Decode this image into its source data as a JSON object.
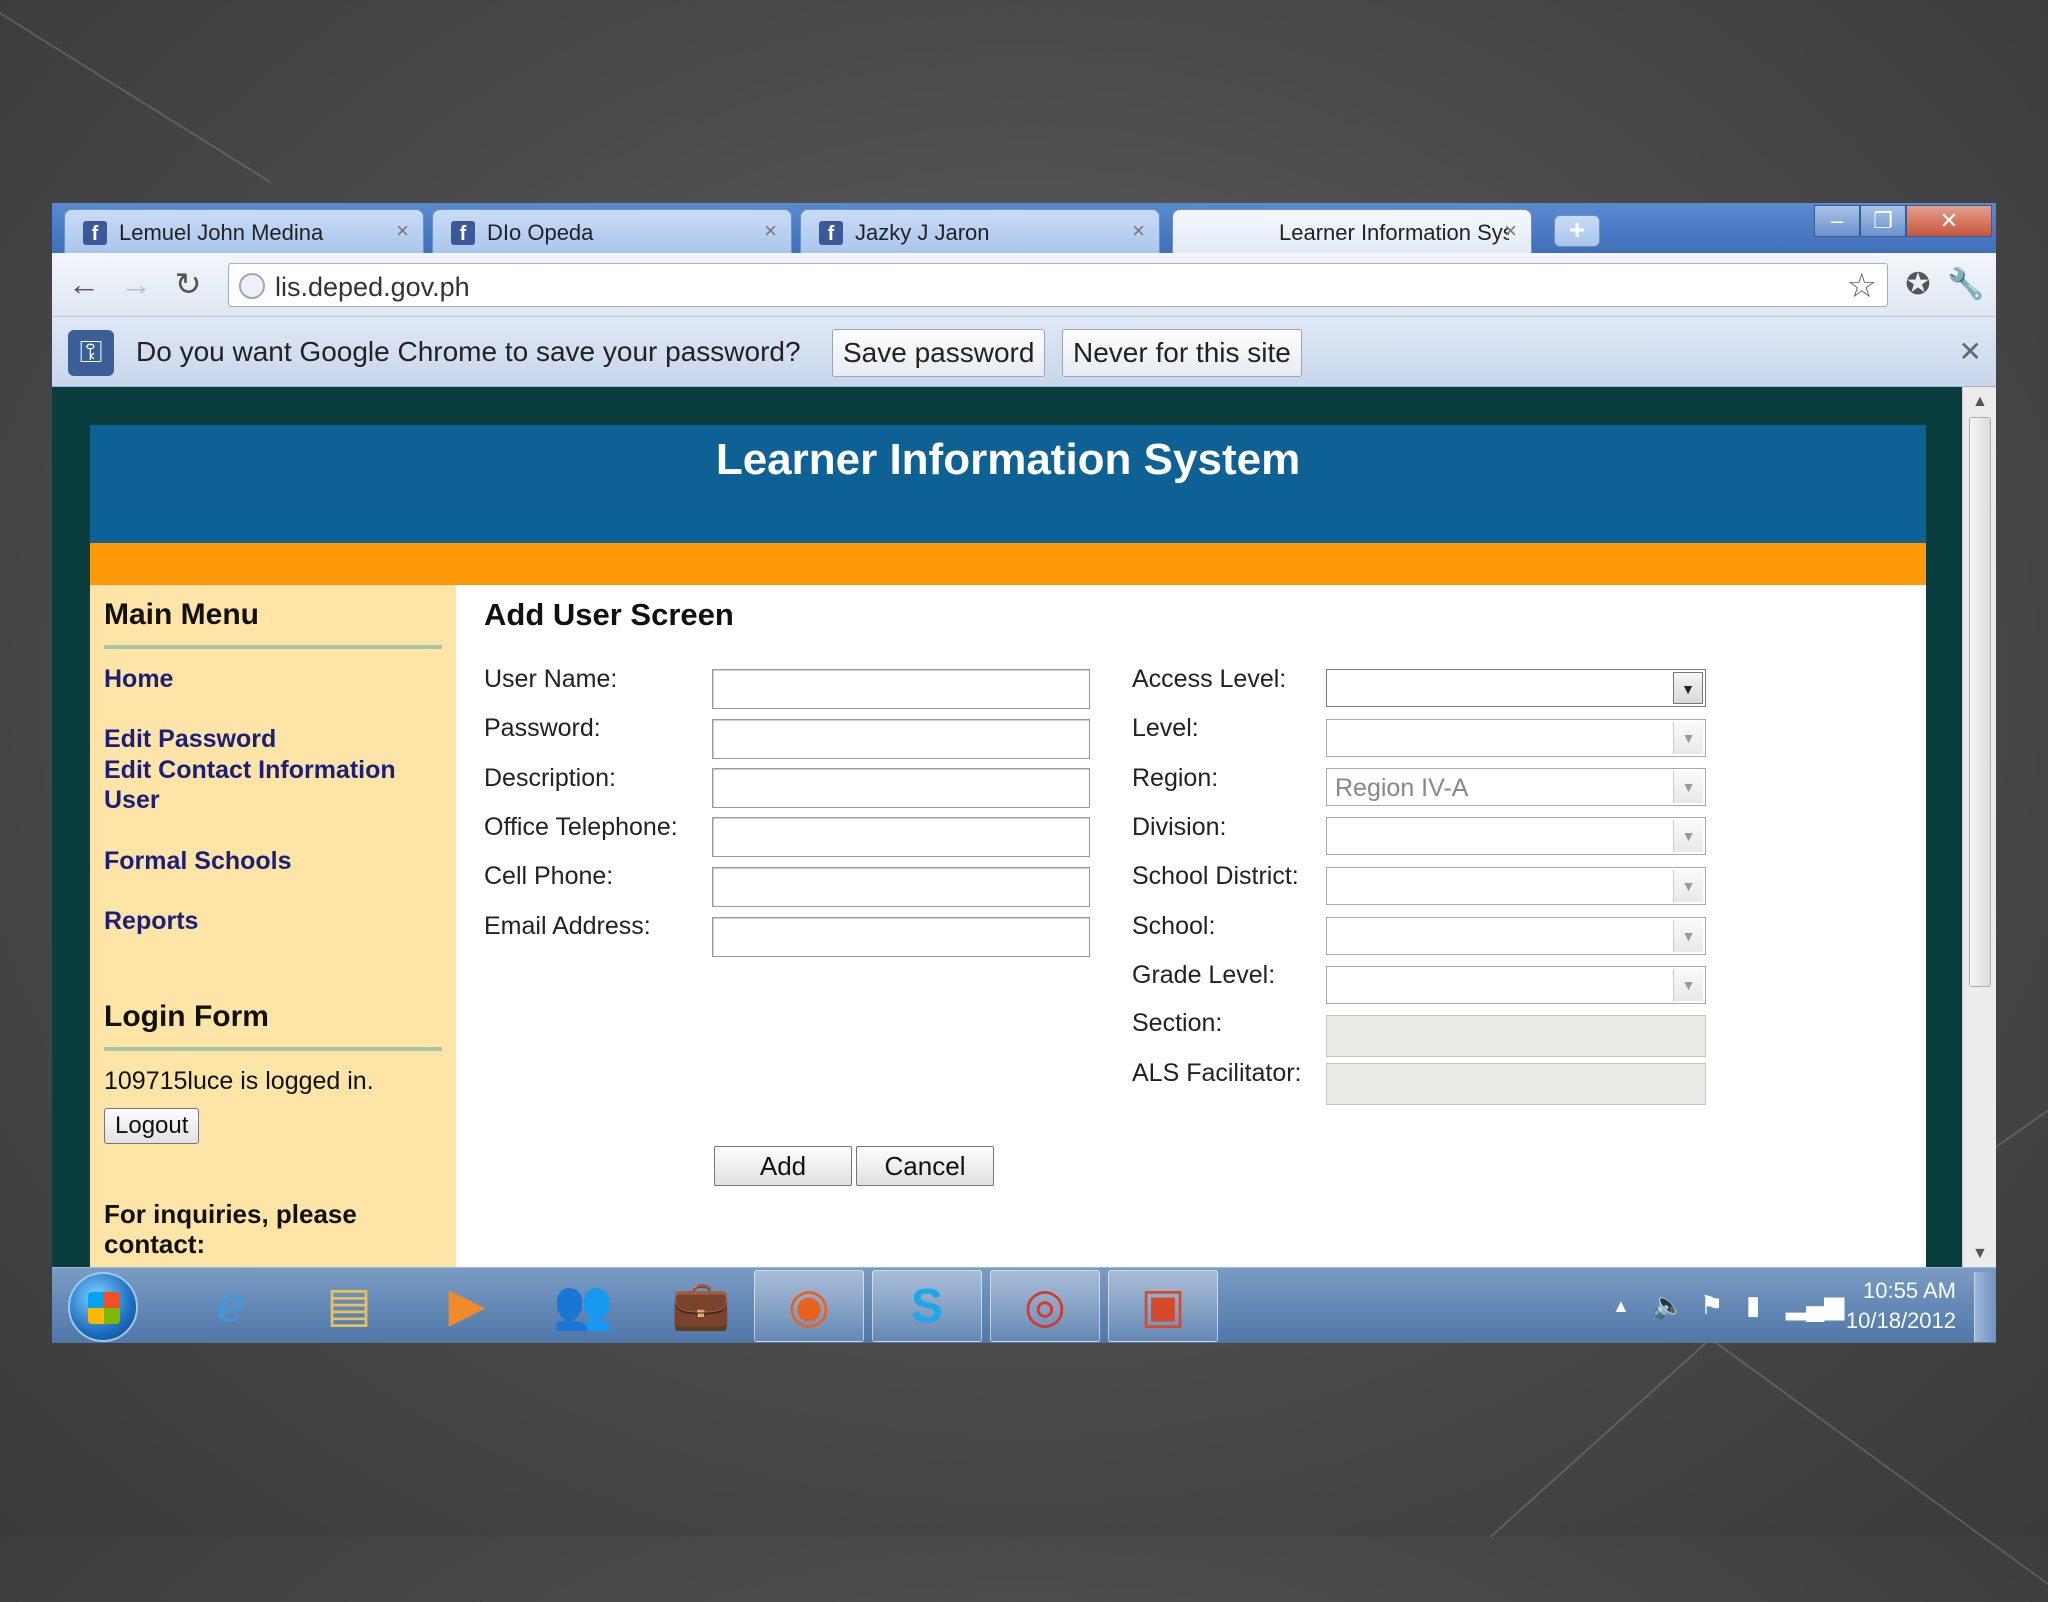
{
  "browser": {
    "tabs": [
      {
        "label": "Lemuel John Medina",
        "favicon": "facebook-icon"
      },
      {
        "label": "DIo Opeda",
        "favicon": "facebook-icon"
      },
      {
        "label": "Jazky J Jaron",
        "favicon": "facebook-icon"
      },
      {
        "label": "Learner Information System",
        "active": true
      }
    ],
    "url": "lis.deped.gov.ph",
    "infobar": {
      "message": "Do you want Google Chrome to save your password?",
      "save_label": "Save password",
      "never_label": "Never for this site"
    }
  },
  "site": {
    "title": "Learner Information System",
    "colors": {
      "header": "#0d6195",
      "band": "#fe9a0a",
      "sidebar": "#ffe4a8"
    },
    "sidebar": {
      "menu_heading": "Main Menu",
      "links": {
        "home": "Home",
        "edit_password": "Edit Password",
        "edit_contact": "Edit Contact Information",
        "user": "User",
        "formal_schools": "Formal Schools",
        "reports": "Reports"
      },
      "login_heading": "Login Form",
      "logged_in_text": "109715luce is logged in.",
      "logout_label": "Logout",
      "inquiry_text": "For inquiries, please contact:"
    },
    "form": {
      "heading": "Add User Screen",
      "left_labels": {
        "user_name": "User Name:",
        "password": "Password:",
        "description": "Description:",
        "office_telephone": "Office Telephone:",
        "cell_phone": "Cell Phone:",
        "email_address": "Email Address:"
      },
      "right_labels": {
        "access_level": "Access Level:",
        "level": "Level:",
        "region": "Region:",
        "division": "Division:",
        "school_district": "School District:",
        "school": "School:",
        "grade_level": "Grade Level:",
        "section": "Section:",
        "als_facilitator": "ALS Facilitator:"
      },
      "region_value": "Region IV-A",
      "add_label": "Add",
      "cancel_label": "Cancel"
    }
  },
  "taskbar": {
    "time": "10:55 AM",
    "date": "10/18/2012"
  }
}
